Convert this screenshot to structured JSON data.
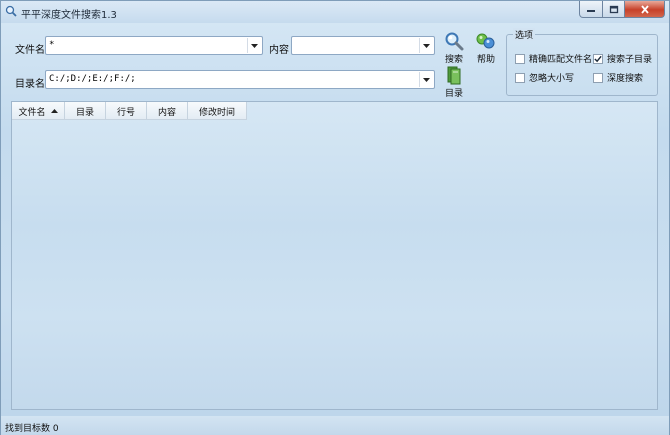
{
  "window": {
    "title": "平平深度文件搜索1.3"
  },
  "form": {
    "filename_label": "文件名",
    "filename_value": "*",
    "content_label": "内容",
    "content_value": "",
    "directory_label": "目录名",
    "directory_value": "C:/;D:/;E:/;F:/;"
  },
  "toolbar": {
    "search_label": "搜索",
    "help_label": "帮助",
    "directory_label": "目录"
  },
  "options": {
    "title": "选项",
    "items": [
      {
        "label": "精确匹配文件名",
        "checked": false
      },
      {
        "label": "搜索子目录",
        "checked": true
      },
      {
        "label": "忽略大小写",
        "checked": false
      },
      {
        "label": "深度搜索",
        "checked": false
      }
    ]
  },
  "list": {
    "columns": [
      "文件名",
      "目录",
      "行号",
      "内容",
      "修改时间"
    ]
  },
  "status": {
    "text": "找到目标数 0"
  }
}
